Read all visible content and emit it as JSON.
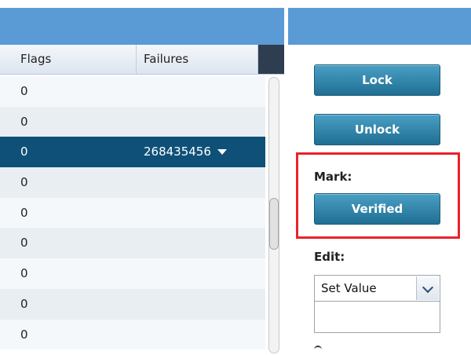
{
  "grid": {
    "columns": {
      "flags": "Flags",
      "failures": "Failures"
    },
    "rows": [
      {
        "flags": "0",
        "failures": ""
      },
      {
        "flags": "0",
        "failures": ""
      },
      {
        "flags": "0",
        "failures": "268435456",
        "selected": true
      },
      {
        "flags": "0",
        "failures": ""
      },
      {
        "flags": "0",
        "failures": ""
      },
      {
        "flags": "0",
        "failures": ""
      },
      {
        "flags": "0",
        "failures": ""
      },
      {
        "flags": "0",
        "failures": ""
      },
      {
        "flags": "0",
        "failures": ""
      }
    ]
  },
  "actions": {
    "lock_label": "Lock",
    "unlock_label": "Unlock",
    "mark_label": "Mark:",
    "verified_label": "Verified",
    "edit_label": "Edit:",
    "edit_select_value": "Set Value",
    "edit_value": ""
  },
  "colors": {
    "header_band": "#5b9bd5",
    "selected_row": "#0f5078",
    "button": "#2b82a8",
    "highlight_box": "#e8232a"
  }
}
